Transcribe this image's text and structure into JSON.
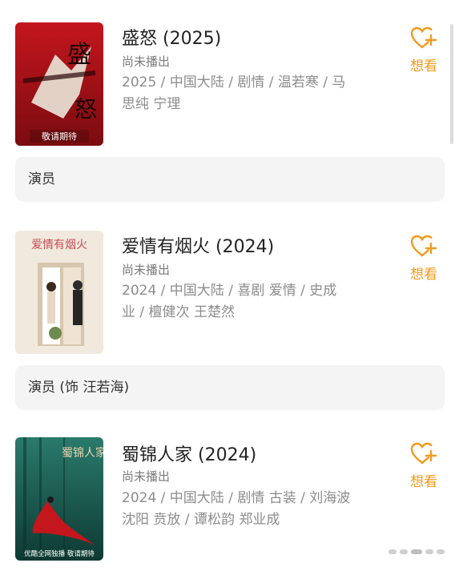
{
  "accent_color": "#f29a1d",
  "items": [
    {
      "title": "盛怒 (2025)",
      "status": "尚未播出",
      "meta_line1": "2025 / 中国大陆 / 剧情 / 温若寒 / 马",
      "meta_line2": "思纯 宁理",
      "want_label": "想看",
      "role": "演员",
      "poster": {
        "text_main": "盛",
        "text_second": "怒",
        "caption": "敬请期待",
        "colors": [
          "#b8131a",
          "#5a0a0c"
        ]
      }
    },
    {
      "title": "爱情有烟火 (2024)",
      "status": "尚未播出",
      "meta_line1": "2024 / 中国大陆 / 喜剧 爱情 / 史成",
      "meta_line2": "业 / 檀健次 王楚然",
      "want_label": "想看",
      "role": "演员 (饰 汪若海)",
      "poster": {
        "text_main": "爱情有烟火",
        "colors": [
          "#f3ece4",
          "#d8c9b6"
        ]
      }
    },
    {
      "title": "蜀锦人家 (2024)",
      "status": "尚未播出",
      "meta_line1": "2024 / 中国大陆 / 剧情 古装 / 刘海波",
      "meta_line2": "沈阳 贲放 / 谭松韵 郑业成",
      "want_label": "想看",
      "poster": {
        "text_main": "蜀锦人家",
        "caption": "优酷全网独播 敬请期待",
        "colors": [
          "#1f6b5e",
          "#0f3c35"
        ]
      }
    }
  ]
}
